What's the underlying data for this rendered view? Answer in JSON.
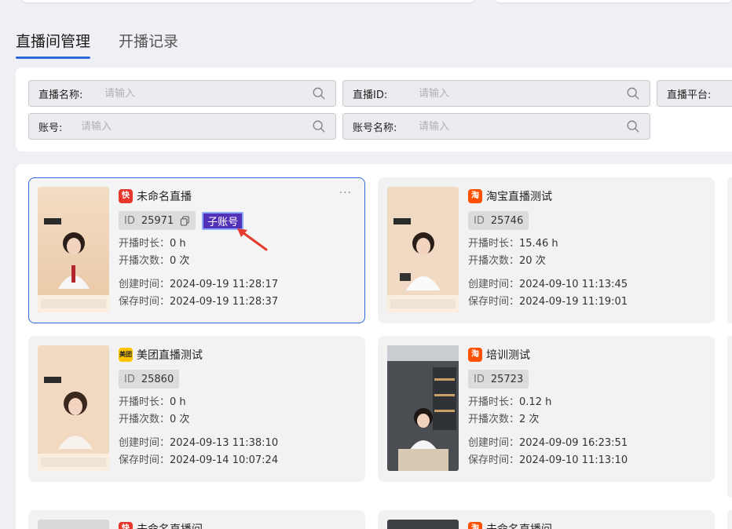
{
  "tabs": [
    {
      "label": "直播间管理",
      "active": true
    },
    {
      "label": "开播记录",
      "active": false
    }
  ],
  "filters": {
    "live_name": {
      "label": "直播名称:",
      "placeholder": "请输入"
    },
    "live_id": {
      "label": "直播ID:",
      "placeholder": "请输入"
    },
    "platform": {
      "label": "直播平台:"
    },
    "account": {
      "label": "账号:",
      "placeholder": "请输入"
    },
    "account_name": {
      "label": "账号名称:",
      "placeholder": "请输入"
    }
  },
  "labels": {
    "id": "ID",
    "duration": "开播时长：",
    "count": "开播次数：",
    "created": "创建时间：",
    "saved": "保存时间：",
    "sub_account": "子账号",
    "more": "···"
  },
  "cards": [
    {
      "title": "未命名直播",
      "platform_icon": "kuaishou-icon",
      "platform_color": "#e8372c",
      "platform_glyph": "快",
      "id": "25971",
      "duration": "0 h",
      "count": "0 次",
      "created": "2024-09-19 11:28:17",
      "saved": "2024-09-19 11:28:37",
      "sub_account": true
    },
    {
      "title": "淘宝直播测试",
      "platform_icon": "taobao-icon",
      "platform_color": "#ff5000",
      "platform_glyph": "淘",
      "id": "25746",
      "duration": "15.46 h",
      "count": "20 次",
      "created": "2024-09-10 11:13:45",
      "saved": "2024-09-19 11:19:01",
      "sub_account": false
    },
    {
      "title": "美团直播测试",
      "platform_icon": "meituan-icon",
      "platform_color": "#ffc300",
      "platform_glyph": "美团",
      "id": "25860",
      "duration": "0 h",
      "count": "0 次",
      "created": "2024-09-13 11:38:10",
      "saved": "2024-09-14 10:07:24",
      "sub_account": false
    },
    {
      "title": "培训测试",
      "platform_icon": "taobao-icon",
      "platform_color": "#ff5000",
      "platform_glyph": "淘",
      "id": "25723",
      "duration": "0.12 h",
      "count": "2 次",
      "created": "2024-09-09 16:23:51",
      "saved": "2024-09-10 11:13:10",
      "sub_account": false
    },
    {
      "title": "未命名直播间",
      "platform_icon": "kuaishou-icon",
      "platform_color": "#e8372c",
      "platform_glyph": "快"
    },
    {
      "title": "未命名直播间",
      "platform_icon": "taobao-icon",
      "platform_color": "#ff5000",
      "platform_glyph": "淘"
    }
  ],
  "colors": {
    "accent": "#2f6bdc",
    "sub_badge": "#5131b8",
    "annotation_arrow": "#e53a2e"
  }
}
